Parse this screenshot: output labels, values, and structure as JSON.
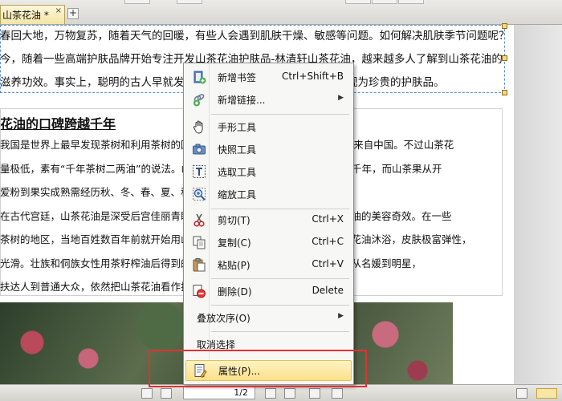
{
  "tab": {
    "title": "山茶花油 *",
    "close": "×",
    "add": "+"
  },
  "document": {
    "intro_lines": [
      "春回大地，万物复苏，随着天气的回暖，有些人会遇到肌肤干燥、敏感等问题。如何解决肌肤季节问题呢？",
      "今，随着一些高端护肤品牌开始专注开发山茶花油护肤品-林清轩山茶花油，越来越多人了解到山茶花油的",
      "滋养功效。事实上，聪明的古人早就发现了山茶花油的护肤功效，并将其视为珍贵的护肤品。"
    ],
    "heading": "花油的口碑跨越千年",
    "body_lines": [
      "我国是世界上最早发现茶树和利用茶树的国家，全世界山茶花油产量的90%以上来自中国。不过山茶花",
      "量极低，素有“千年茶树二两油”的说法。山茶树生长缓慢，有些茶树树龄可达上千年，而山茶果从开",
      "爱粉到果实成熟需经历秋、冬、春、夏、秋五个季节。",
      "在古代宫廷，山茶花油是深受后宫佳丽青睐的美容圣品，民间也早已发现山茶花油的美容奇效。在一些",
      "茶树的地区，当地百姓数百年前就开始用山茶花油护肤护发，用山茶花油和山茶花油沐浴，皮肤极富弹性，",
      "光滑。壮族和侗族女性用茶籽榨油后得到的山茶花油护理头发，如今无论中外，从名媛到明星，",
      "扶达人到普通大众，依然把山茶花油看作护肤的秘密武器。"
    ]
  },
  "context_menu": {
    "items": [
      {
        "label": "新增书签",
        "shortcut": "Ctrl+Shift+B",
        "icon": "bookmark-add-icon"
      },
      {
        "label": "新增链接...",
        "shortcut": "",
        "submenu": true,
        "icon": "link-add-icon"
      },
      {
        "label": "手形工具",
        "shortcut": "",
        "icon": "hand-tool-icon"
      },
      {
        "label": "快照工具",
        "shortcut": "",
        "icon": "camera-icon"
      },
      {
        "label": "选取工具",
        "shortcut": "",
        "icon": "text-select-icon"
      },
      {
        "label": "缩放工具",
        "shortcut": "",
        "icon": "zoom-icon"
      },
      {
        "label": "剪切(T)",
        "shortcut": "Ctrl+X",
        "icon": "scissors-icon"
      },
      {
        "label": "复制(C)",
        "shortcut": "Ctrl+C",
        "icon": "copy-icon"
      },
      {
        "label": "粘贴(P)",
        "shortcut": "Ctrl+V",
        "icon": "paste-icon"
      },
      {
        "label": "删除(D)",
        "shortcut": "Delete",
        "icon": "delete-icon"
      },
      {
        "label": "叠放次序(O)",
        "shortcut": "",
        "submenu": true
      },
      {
        "label": "取消选择",
        "shortcut": ""
      },
      {
        "label": "属性(P)...",
        "shortcut": "",
        "icon": "properties-icon",
        "highlighted": true
      }
    ],
    "submenu_arrow": "▶"
  },
  "statusbar": {
    "page_current": "1",
    "page_total": "2"
  },
  "colors": {
    "highlight": "#fbe08a",
    "annotation": "#e03232",
    "selection": "#5b8fd8"
  }
}
